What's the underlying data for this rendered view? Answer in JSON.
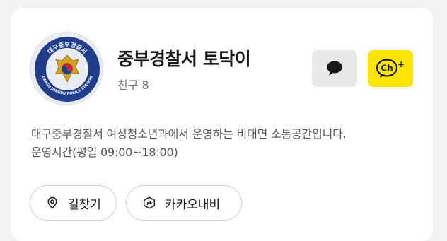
{
  "channel": {
    "name": "중부경찰서 토닥이",
    "friends": "친구 8",
    "logo": {
      "top_text": "대구중부경찰서",
      "ring_text": "DAEGU JUNGBU POLICE STATION"
    }
  },
  "description": {
    "line1": "대구중부경찰서 여성청소년과에서 운영하는 비대면 소통공간입니다.",
    "line2": "운영시간(평일 09:00~18:00)"
  },
  "actions": {
    "chat_icon": "chat-bubble-icon",
    "channel_add": "Ch+",
    "route_label": "길찾기",
    "route_icon": "location-pin-icon",
    "navi_label": "카카오내비",
    "navi_icon": "navigation-turn-icon"
  },
  "colors": {
    "kakao_yellow": "#fee500",
    "chat_button_bg": "#e9e9e9",
    "logo_navy": "#1f3d8a"
  }
}
